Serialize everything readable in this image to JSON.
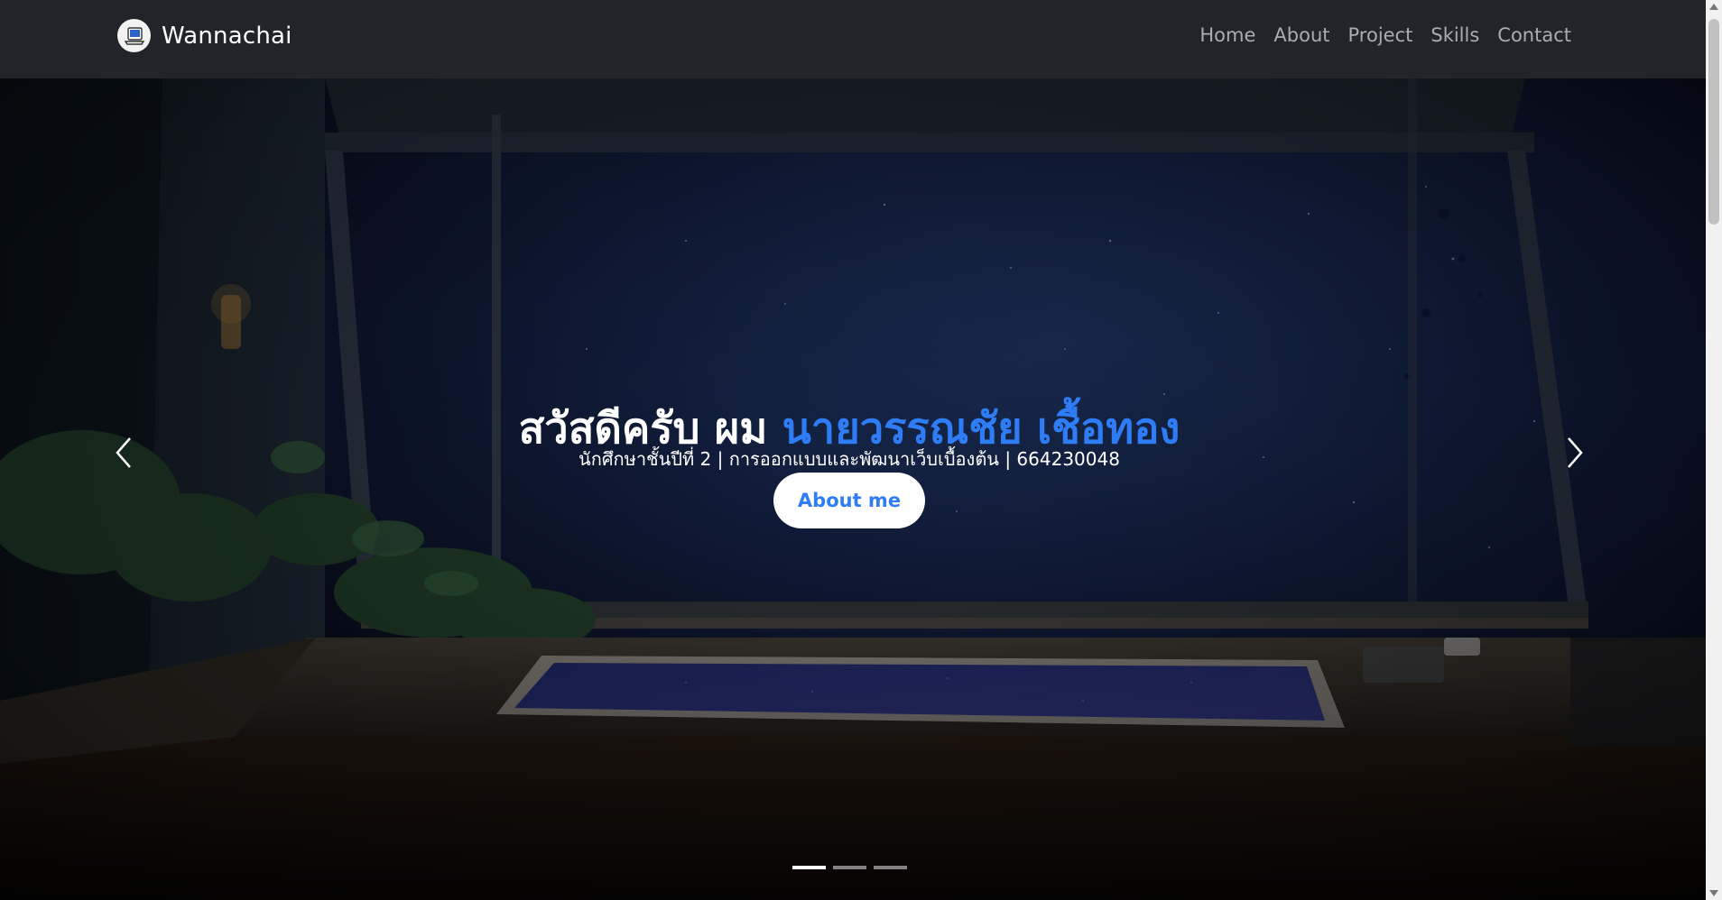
{
  "header": {
    "brand_name": "Wannachai",
    "brand_logo_icon": "laptop-avatar-icon",
    "nav": [
      {
        "label": "Home"
      },
      {
        "label": "About"
      },
      {
        "label": "Project"
      },
      {
        "label": "Skills"
      },
      {
        "label": "Contact"
      }
    ]
  },
  "hero": {
    "title_prefix": "สวัสดีครับ ผม ",
    "title_name": "นายวรรณชัย เชื้อทอง",
    "subtitle": "นักศึกษาชั้นปีที่ 2 | การออกแบบและพัฒนาเว็บเบื้องต้น | 664230048",
    "cta_label": "About me",
    "prev_icon": "chevron-left-icon",
    "next_icon": "chevron-right-icon",
    "indicators": [
      {
        "active": true
      },
      {
        "active": false
      },
      {
        "active": false
      }
    ]
  },
  "colors": {
    "navbar_bg": "#212529",
    "nav_text": "#a9acb0",
    "accent": "#2f7df6",
    "button_bg": "#ffffff"
  }
}
